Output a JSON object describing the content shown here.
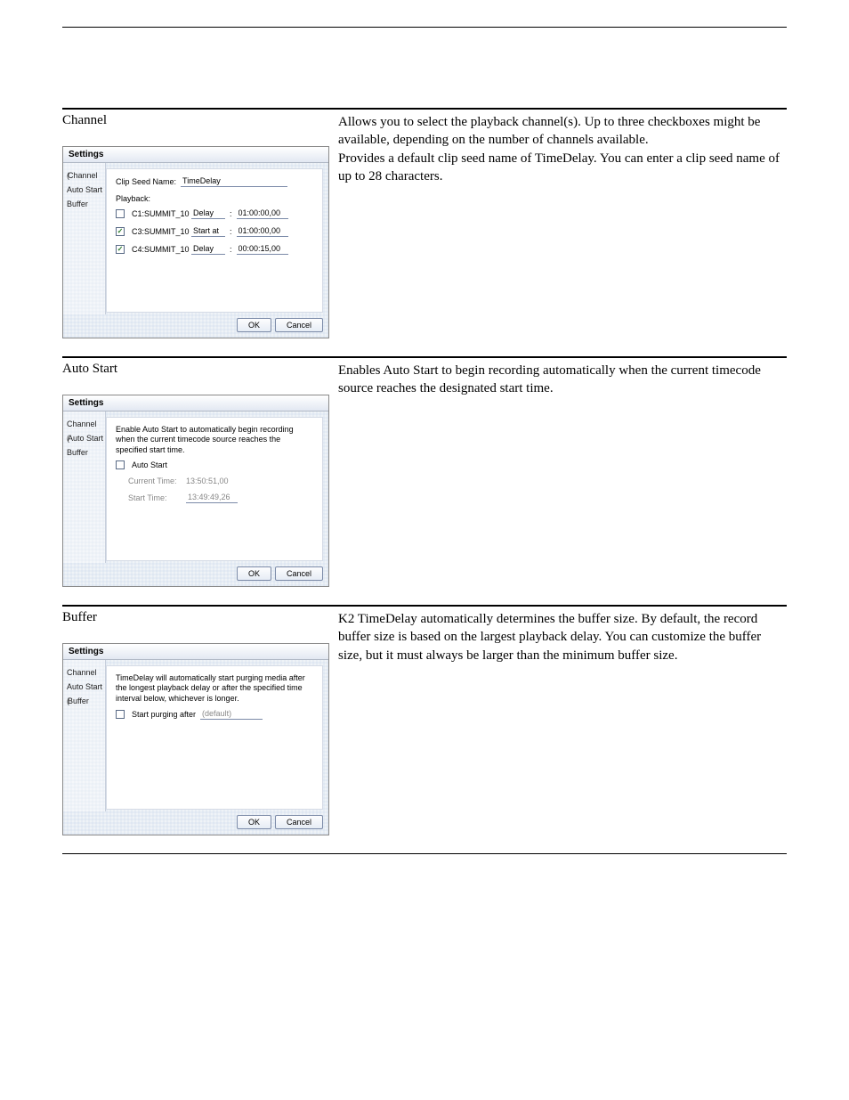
{
  "section_channel": {
    "title": "Channel",
    "desc_p1": "Allows you to select the playback channel(s). Up to three checkboxes might be available, depending on the number of channels available.",
    "desc_p2": "Provides a default clip seed name of TimeDelay. You can enter a clip seed name of up to 28 characters."
  },
  "section_autostart": {
    "title": "Auto Start",
    "desc": "Enables Auto Start to begin recording automatically when the current timecode source reaches the designated start time."
  },
  "section_buffer": {
    "title": "Buffer",
    "desc": "K2 TimeDelay automatically determines the buffer size. By default, the record buffer size is based on the largest playback delay. You can customize the buffer size, but it must always be larger than the minimum buffer size."
  },
  "dlg": {
    "title": "Settings",
    "sidebar": {
      "channel": "Channel",
      "autostart": "Auto Start",
      "buffer": "Buffer"
    },
    "ok": "OK",
    "cancel": "Cancel"
  },
  "channel_pane": {
    "seed_label": "Clip Seed Name:",
    "seed_value": "TimeDelay",
    "playback_label": "Playback:",
    "rows": [
      {
        "checked": false,
        "name": "C1:SUMMIT_10",
        "mode": "Delay",
        "tc": "01:00:00,00"
      },
      {
        "checked": true,
        "name": "C3:SUMMIT_10",
        "mode": "Start at",
        "tc": "01:00:00,00"
      },
      {
        "checked": true,
        "name": "C4:SUMMIT_10",
        "mode": "Delay",
        "tc": "00:00:15,00"
      }
    ]
  },
  "autostart_pane": {
    "blurb": "Enable Auto Start to automatically begin recording when the current timecode source reaches the specified start time.",
    "cb_label": "Auto Start",
    "current_label": "Current Time:",
    "current_value": "13:50:51,00",
    "start_label": "Start Time:",
    "start_value": "13:49:49,26"
  },
  "buffer_pane": {
    "blurb": "TimeDelay will automatically start purging media after the longest playback delay or after the specified time interval below, whichever is longer.",
    "cb_label": "Start purging after",
    "value": "(default)"
  }
}
